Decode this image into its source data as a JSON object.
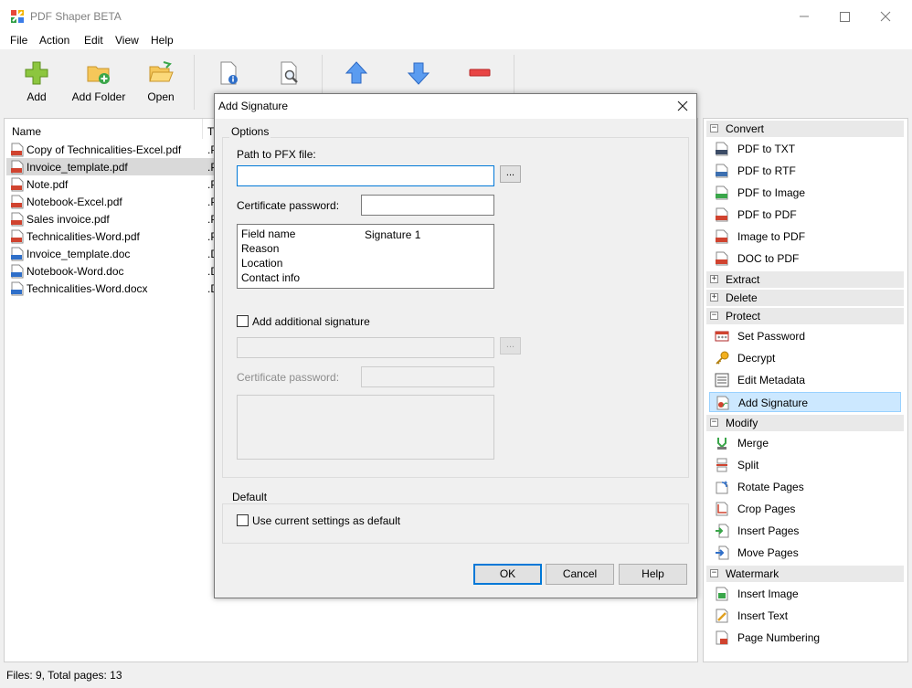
{
  "window": {
    "title": "PDF Shaper BETA"
  },
  "menu": [
    "File",
    "Action",
    "Edit",
    "View",
    "Help"
  ],
  "toolbar": [
    {
      "label": "Add",
      "icon": "add-icon"
    },
    {
      "label": "Add Folder",
      "icon": "add-folder-icon"
    },
    {
      "label": "Open",
      "icon": "open-folder-icon"
    },
    {
      "label": "",
      "icon": "document-info-icon"
    },
    {
      "label": "",
      "icon": "document-preview-icon"
    },
    {
      "label": "",
      "icon": "move-up-icon"
    },
    {
      "label": "",
      "icon": "move-down-icon"
    },
    {
      "label": "",
      "icon": "remove-icon"
    }
  ],
  "filelist": {
    "columns": {
      "name": "Name",
      "type": "Ty"
    },
    "files": [
      {
        "name": "Copy of Technicalities-Excel.pdf",
        "type": ".P",
        "kind": "pdf"
      },
      {
        "name": "Invoice_template.pdf",
        "type": ".P",
        "kind": "pdf"
      },
      {
        "name": "Note.pdf",
        "type": ".P",
        "kind": "pdf"
      },
      {
        "name": "Notebook-Excel.pdf",
        "type": ".P",
        "kind": "pdf"
      },
      {
        "name": "Sales invoice.pdf",
        "type": ".P",
        "kind": "pdf"
      },
      {
        "name": "Technicalities-Word.pdf",
        "type": ".P",
        "kind": "pdf"
      },
      {
        "name": "Invoice_template.doc",
        "type": ".D",
        "kind": "doc"
      },
      {
        "name": "Notebook-Word.doc",
        "type": ".D",
        "kind": "doc"
      },
      {
        "name": "Technicalities-Word.docx",
        "type": ".D",
        "kind": "doc"
      }
    ],
    "selected_index": 1
  },
  "sidepanel": {
    "convert": {
      "label": "Convert",
      "expanded": true,
      "items": [
        "PDF to TXT",
        "PDF to RTF",
        "PDF to Image",
        "PDF to PDF",
        "Image to PDF",
        "DOC to PDF"
      ]
    },
    "extract": {
      "label": "Extract",
      "expanded": false
    },
    "delete": {
      "label": "Delete",
      "expanded": false
    },
    "protect": {
      "label": "Protect",
      "expanded": true,
      "items": [
        "Set Password",
        "Decrypt",
        "Edit Metadata",
        "Add Signature"
      ]
    },
    "modify": {
      "label": "Modify",
      "expanded": true,
      "items": [
        "Merge",
        "Split",
        "Rotate Pages",
        "Crop Pages",
        "Insert Pages",
        "Move Pages"
      ]
    },
    "watermark": {
      "label": "Watermark",
      "expanded": true,
      "items": [
        "Insert Image",
        "Insert Text",
        "Page Numbering"
      ]
    },
    "selected_item": "Add Signature"
  },
  "status": "Files: 9, Total pages: 13",
  "dialog": {
    "title": "Add Signature",
    "options_group": "Options",
    "pfx_label": "Path to PFX file:",
    "pfx_value": "",
    "browse_label": "...",
    "cert_pw_label": "Certificate password:",
    "cert_pw_value": "",
    "fields": [
      {
        "key": "Field name",
        "value": "Signature 1"
      },
      {
        "key": "Reason",
        "value": ""
      },
      {
        "key": "Location",
        "value": ""
      },
      {
        "key": "Contact info",
        "value": ""
      }
    ],
    "additional_sig_label": "Add additional signature",
    "additional_sig_checked": false,
    "cert_pw2_label": "Certificate password:",
    "default_group": "Default",
    "default_checkbox_label": "Use current settings as default",
    "default_checked": false,
    "ok_label": "OK",
    "cancel_label": "Cancel",
    "help_label": "Help"
  }
}
